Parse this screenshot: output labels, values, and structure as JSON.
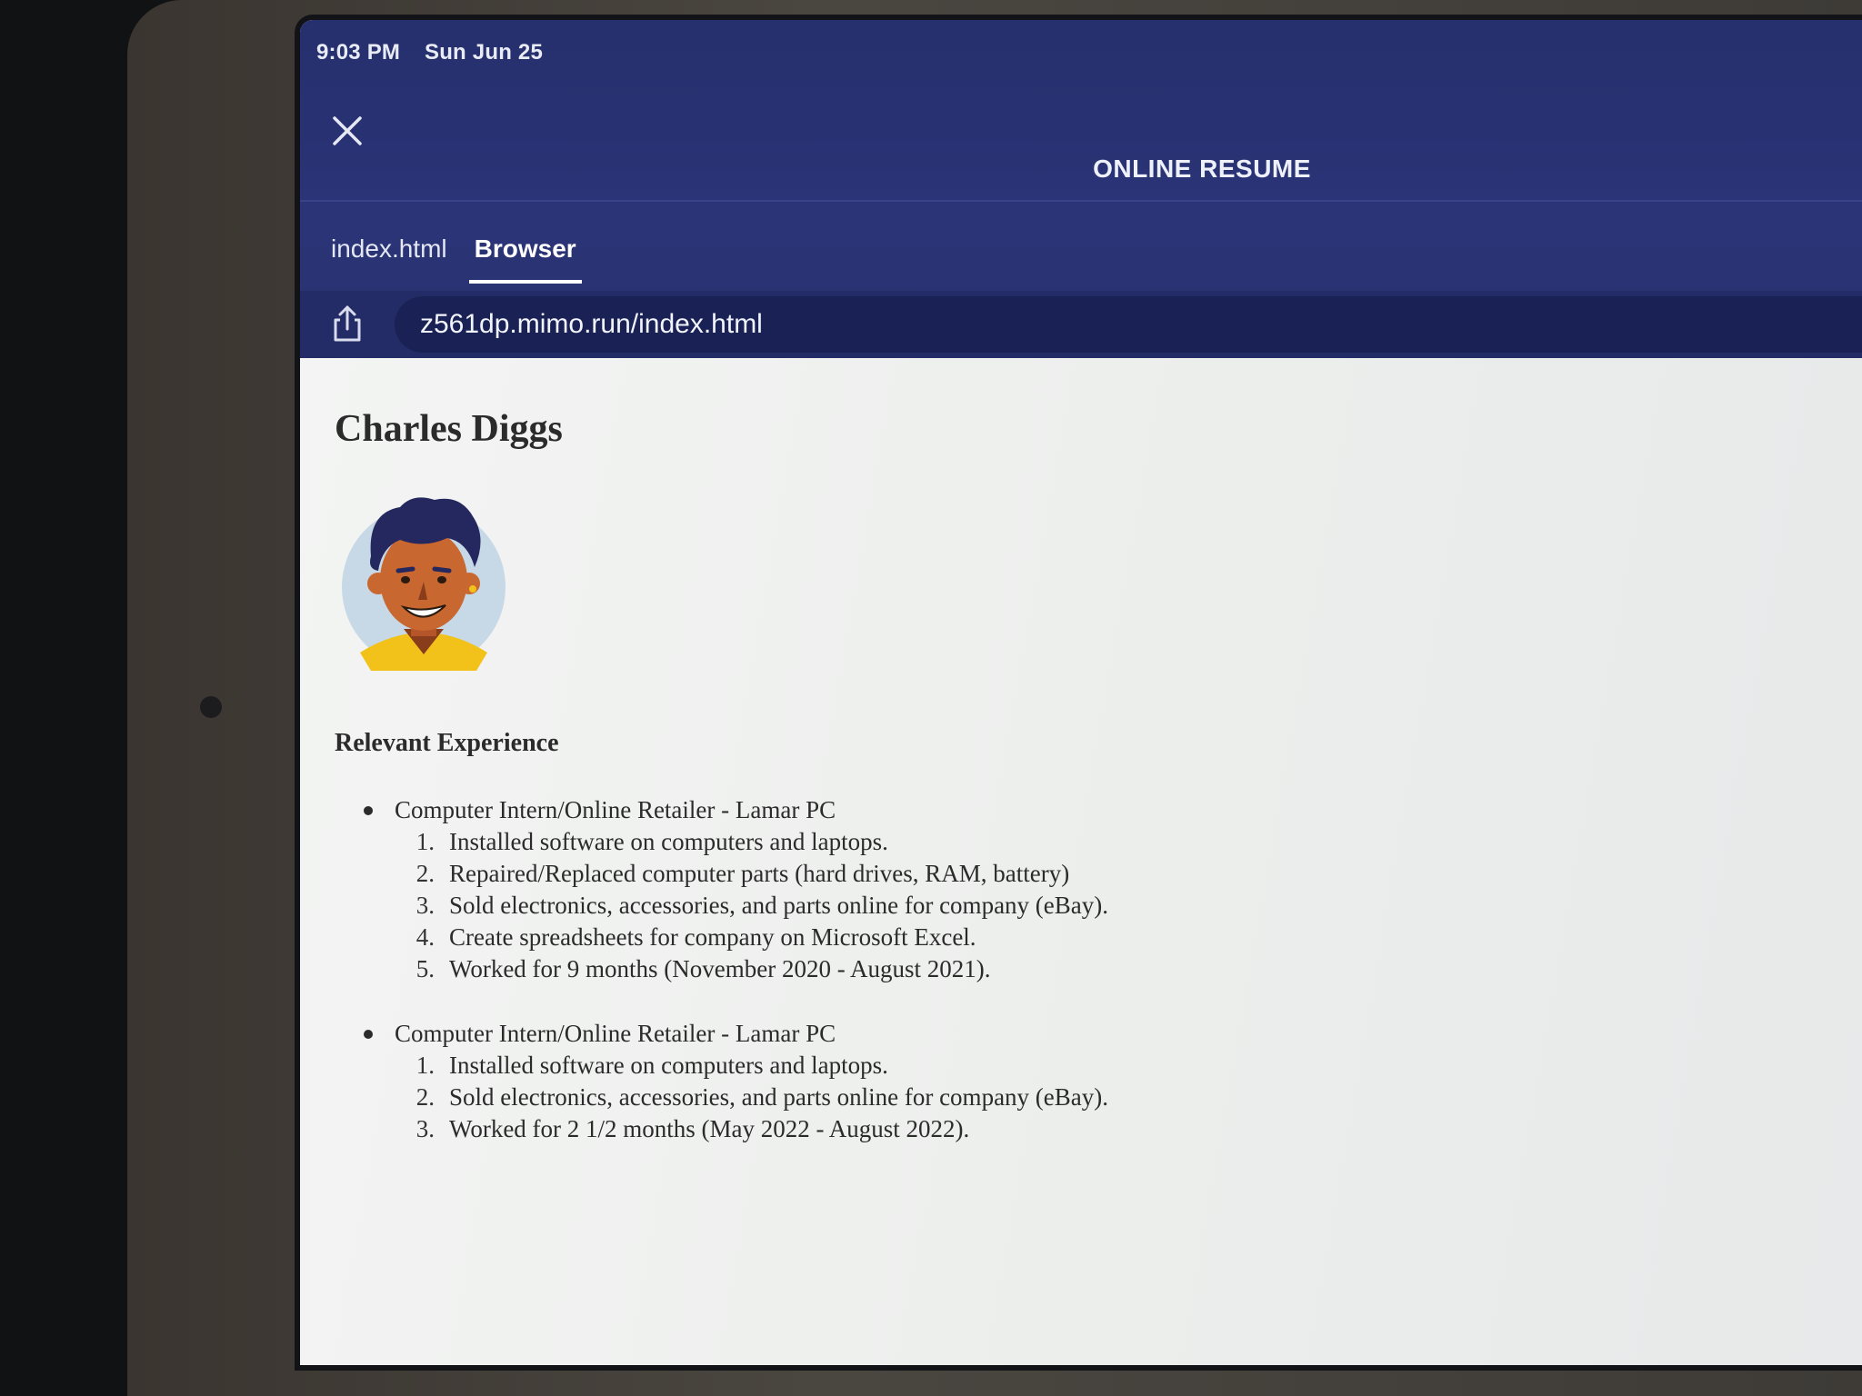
{
  "status_bar": {
    "time": "9:03 PM",
    "date": "Sun Jun 25"
  },
  "header": {
    "title": "ONLINE RESUME"
  },
  "tabs": [
    {
      "label": "index.html",
      "active": false
    },
    {
      "label": "Browser",
      "active": true
    }
  ],
  "url_bar": {
    "url": "z561dp.mimo.run/index.html"
  },
  "page": {
    "name": "Charles Diggs",
    "section_heading": "Relevant Experience",
    "jobs": [
      {
        "title": "Computer Intern/Online Retailer - Lamar PC",
        "items": [
          {
            "num": "1.",
            "text": "Installed software on computers and laptops."
          },
          {
            "num": "2.",
            "text": "Repaired/Replaced computer parts (hard drives, RAM, battery)"
          },
          {
            "num": "3.",
            "text": "Sold electronics, accessories, and parts online for company (eBay)."
          },
          {
            "num": "4.",
            "text": "Create spreadsheets for company on Microsoft Excel."
          },
          {
            "num": "5.",
            "text": "Worked for 9 months (November 2020 - August 2021)."
          }
        ]
      },
      {
        "title": "Computer Intern/Online Retailer - Lamar PC",
        "items": [
          {
            "num": "1.",
            "text": "Installed software on computers and laptops."
          },
          {
            "num": "2.",
            "text": "Sold electronics, accessories, and parts online for company (eBay)."
          },
          {
            "num": "3.",
            "text": "Worked for 2 1/2 months (May 2022 - August 2022)."
          }
        ]
      }
    ]
  },
  "colors": {
    "header_bg": "#2a3477",
    "url_field_bg": "#1a2154",
    "page_bg": "#eef0ef",
    "avatar_shirt": "#f2c21b",
    "avatar_hair": "#25285e"
  },
  "icons": {
    "close": "close-icon",
    "share": "share-icon"
  }
}
